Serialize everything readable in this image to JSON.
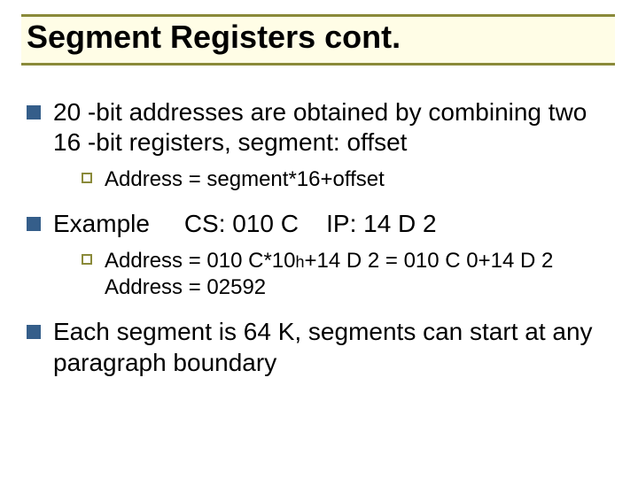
{
  "title": "Segment Registers cont.",
  "items": [
    {
      "text": "20 -bit addresses are obtained by combining two 16 -bit registers, segment: offset",
      "sub": [
        {
          "text": "Address = segment*16+offset"
        }
      ]
    },
    {
      "text_prefix": "Example",
      "text_values": "     CS: 010 C    IP: 14 D 2",
      "sub": [
        {
          "line1_a": "Address = 010 C*10",
          "line1_h": "h",
          "line1_b": "+14 D 2 = 010 C 0+14 D 2",
          "line2": "Address = 02592"
        }
      ]
    },
    {
      "text": "Each segment is 64 K, segments can start at any paragraph boundary"
    }
  ]
}
